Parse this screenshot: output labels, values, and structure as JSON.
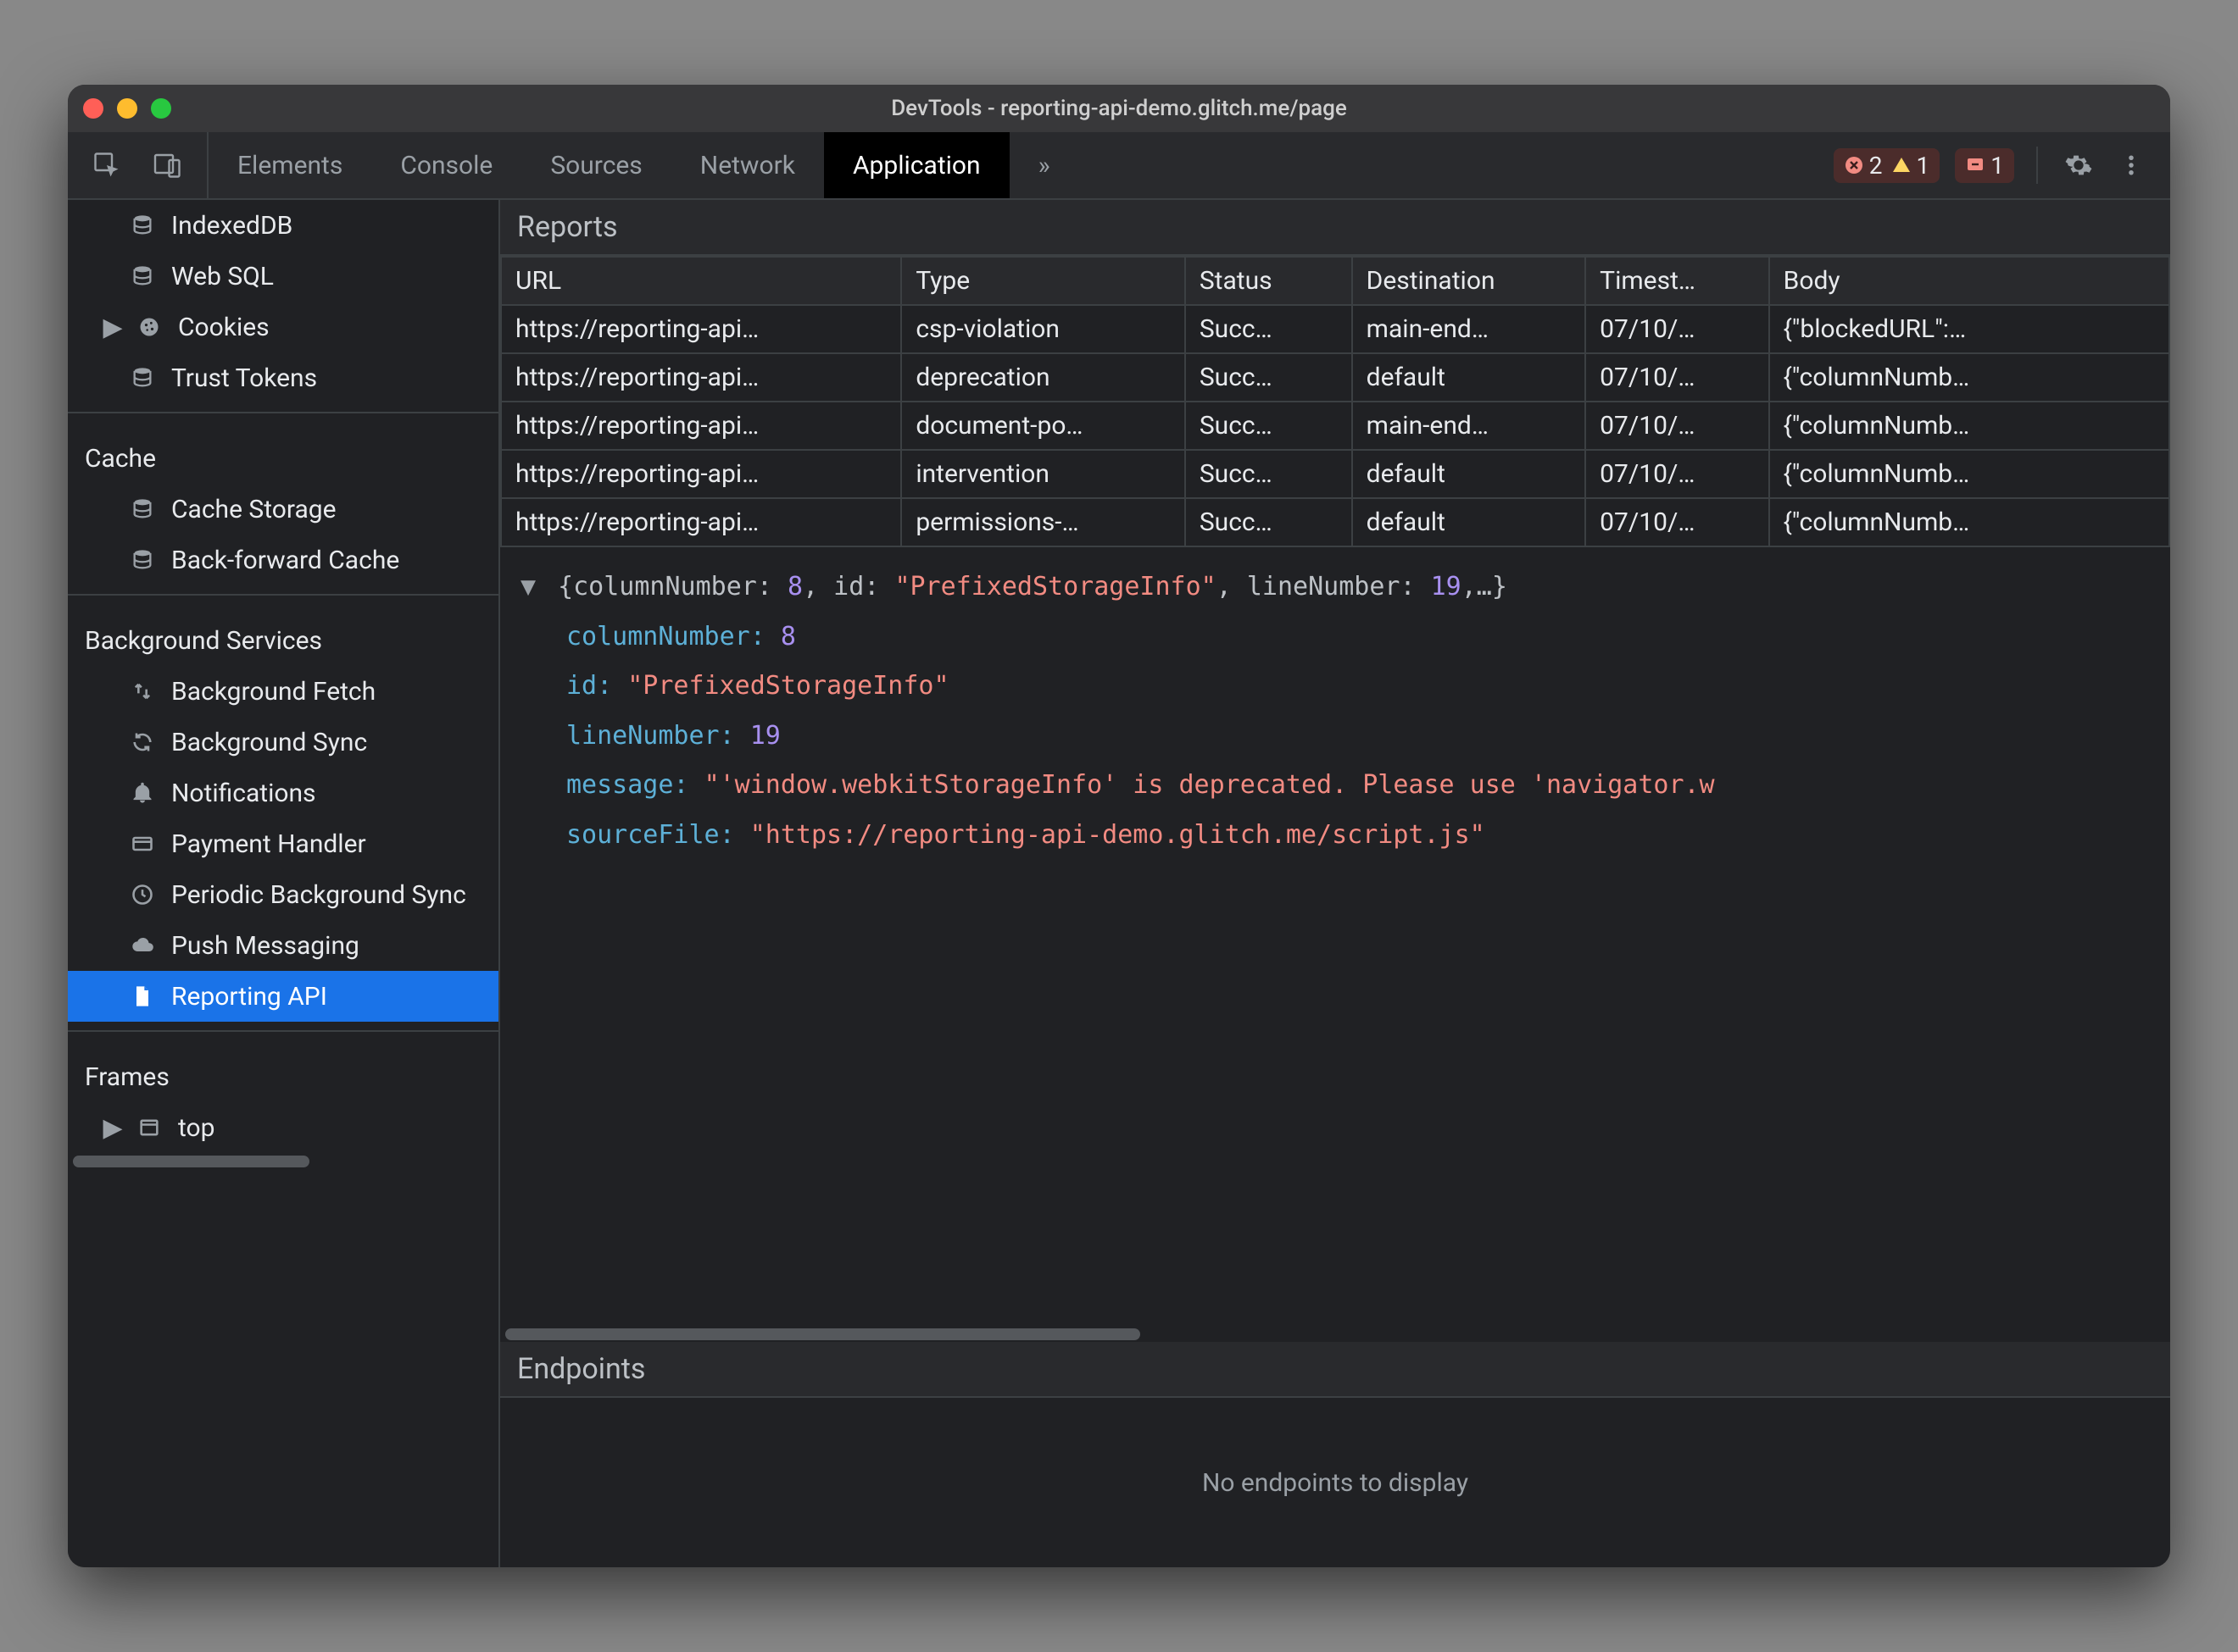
{
  "window": {
    "title": "DevTools - reporting-api-demo.glitch.me/page"
  },
  "toolbar": {
    "tabs": [
      "Elements",
      "Console",
      "Sources",
      "Network",
      "Application"
    ],
    "active_tab_index": 4,
    "more_glyph": "»",
    "errors_count": "2",
    "warnings_count": "1",
    "issues_count": "1"
  },
  "sidebar": {
    "storage_items": [
      {
        "icon": "db",
        "label": "IndexedDB",
        "expandable": false
      },
      {
        "icon": "db",
        "label": "Web SQL",
        "expandable": false
      },
      {
        "icon": "cookie",
        "label": "Cookies",
        "expandable": true
      },
      {
        "icon": "db",
        "label": "Trust Tokens",
        "expandable": false
      }
    ],
    "cache_label": "Cache",
    "cache_items": [
      {
        "icon": "db",
        "label": "Cache Storage"
      },
      {
        "icon": "db",
        "label": "Back-forward Cache"
      }
    ],
    "bg_label": "Background Services",
    "bg_items": [
      {
        "icon": "updown",
        "label": "Background Fetch"
      },
      {
        "icon": "sync",
        "label": "Background Sync"
      },
      {
        "icon": "bell",
        "label": "Notifications"
      },
      {
        "icon": "card",
        "label": "Payment Handler"
      },
      {
        "icon": "clock",
        "label": "Periodic Background Sync"
      },
      {
        "icon": "cloud",
        "label": "Push Messaging"
      },
      {
        "icon": "file",
        "label": "Reporting API",
        "selected": true
      }
    ],
    "frames_label": "Frames",
    "frames_items": [
      {
        "icon": "frame",
        "label": "top",
        "expandable": true
      }
    ]
  },
  "reports": {
    "title": "Reports",
    "columns": [
      "URL",
      "Type",
      "Status",
      "Destination",
      "Timest…",
      "Body"
    ],
    "rows": [
      {
        "url": "https://reporting-api…",
        "type": "csp-violation",
        "status": "Succ…",
        "dest": "main-end…",
        "time": "07/10/…",
        "body": "{\"blockedURL\":…"
      },
      {
        "url": "https://reporting-api…",
        "type": "deprecation",
        "status": "Succ…",
        "dest": "default",
        "time": "07/10/…",
        "body": "{\"columnNumb…"
      },
      {
        "url": "https://reporting-api…",
        "type": "document-po…",
        "status": "Succ…",
        "dest": "main-end…",
        "time": "07/10/…",
        "body": "{\"columnNumb…"
      },
      {
        "url": "https://reporting-api…",
        "type": "intervention",
        "status": "Succ…",
        "dest": "default",
        "time": "07/10/…",
        "body": "{\"columnNumb…"
      },
      {
        "url": "https://reporting-api…",
        "type": "permissions-…",
        "status": "Succ…",
        "dest": "default",
        "time": "07/10/…",
        "body": "{\"columnNumb…"
      }
    ]
  },
  "detail": {
    "summary_prefix": "{columnNumber: ",
    "summary_col": "8",
    "summary_mid1": ", id: ",
    "summary_id": "\"PrefixedStorageInfo\"",
    "summary_mid2": ", lineNumber: ",
    "summary_line": "19",
    "summary_suffix": ",…}",
    "k_columnNumber": "columnNumber:",
    "v_columnNumber": "8",
    "k_id": "id:",
    "v_id": "\"PrefixedStorageInfo\"",
    "k_lineNumber": "lineNumber:",
    "v_lineNumber": "19",
    "k_message": "message:",
    "v_message": "\"'window.webkitStorageInfo' is deprecated. Please use 'navigator.w",
    "k_sourceFile": "sourceFile:",
    "v_sourceFile": "\"https://reporting-api-demo.glitch.me/script.js\""
  },
  "endpoints": {
    "title": "Endpoints",
    "empty": "No endpoints to display"
  }
}
